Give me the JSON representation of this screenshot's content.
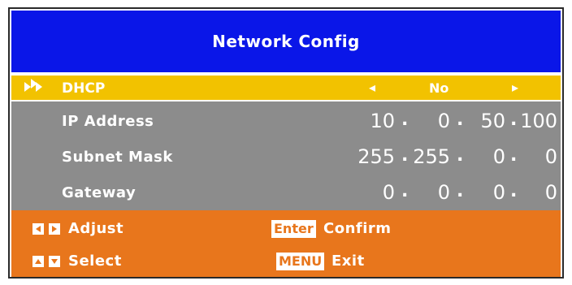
{
  "window": {
    "title": "Network Config"
  },
  "dhcp": {
    "label": "DHCP",
    "left_arrow": "◂",
    "value": "No",
    "right_arrow": "▸"
  },
  "fields": [
    {
      "label": "IP Address",
      "octets": [
        "10",
        "0",
        "50",
        "100"
      ]
    },
    {
      "label": "Subnet Mask",
      "octets": [
        "255",
        "255",
        "0",
        "0"
      ]
    },
    {
      "label": "Gateway",
      "octets": [
        "0",
        "0",
        "0",
        "0"
      ]
    }
  ],
  "hints": {
    "adjust_label": "Adjust",
    "select_label": "Select",
    "enter_key": "Enter",
    "confirm_label": "Confirm",
    "menu_key": "MENU",
    "exit_label": "Exit"
  },
  "colors": {
    "header": "#0a16e8",
    "selected_row": "#f2c200",
    "fields_bg": "#8c8c8c",
    "footer_bg": "#e8761c"
  },
  "icons": [
    "selection-arrows-icon",
    "left-key-icon",
    "right-key-icon",
    "up-key-icon",
    "down-key-icon"
  ]
}
